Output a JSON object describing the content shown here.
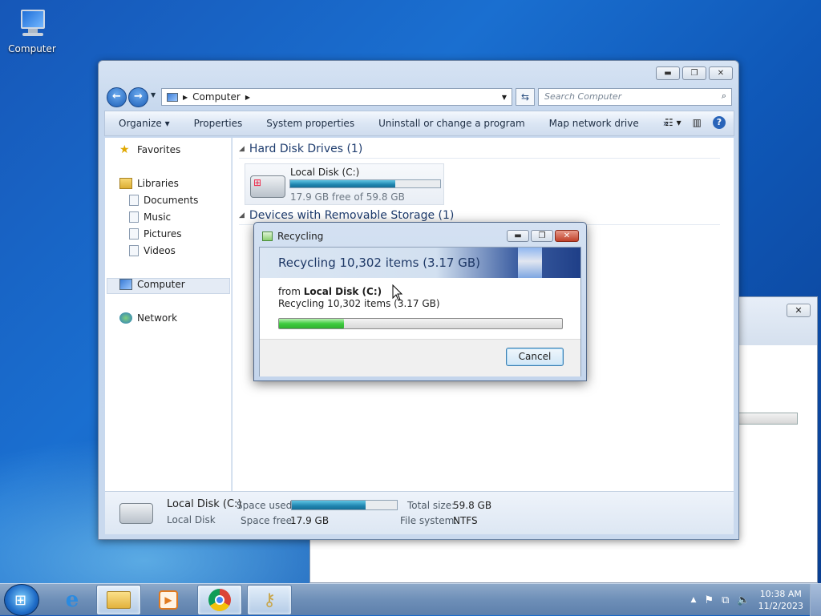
{
  "desktop": {
    "icon_label": "Computer"
  },
  "explorer": {
    "address": {
      "crumb": "Computer"
    },
    "search_placeholder": "Search Computer",
    "commands": [
      "Organize",
      "Properties",
      "System properties",
      "Uninstall or change a program",
      "Map network drive"
    ],
    "more": "»",
    "nav": {
      "favorites": "Favorites",
      "libraries": "Libraries",
      "library_items": [
        "Documents",
        "Music",
        "Pictures",
        "Videos"
      ],
      "computer": "Computer",
      "network": "Network"
    },
    "groups": {
      "hdd": "Hard Disk Drives (1)",
      "removable": "Devices with Removable Storage (1)"
    },
    "drive": {
      "name": "Local Disk (C:)",
      "free_text": "17.9 GB free of 59.8 GB",
      "used_fraction": 0.7
    },
    "details": {
      "name": "Local Disk (C:)",
      "type": "Local Disk",
      "space_used_label": "Space used:",
      "space_free_label": "Space free:",
      "space_free": "17.9 GB",
      "total_label": "Total size:",
      "total": "59.8 GB",
      "fs_label": "File system:",
      "fs": "NTFS"
    }
  },
  "dialog": {
    "title": "Recycling",
    "headline": "Recycling 10,302 items (3.17 GB)",
    "from_prefix": "from",
    "from_source": "Local Disk (C:)",
    "status": "Recycling 10,302 items (3.17 GB)",
    "progress_fraction": 0.23,
    "cancel": "Cancel"
  },
  "taskbar": {
    "time": "10:38 AM",
    "date": "11/2/2023"
  }
}
